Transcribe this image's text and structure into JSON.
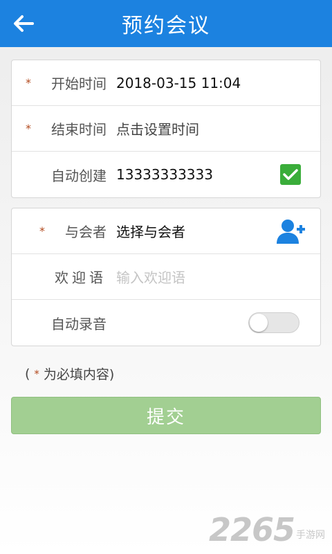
{
  "header": {
    "title": "预约会议",
    "background": "#1c82e0"
  },
  "required_marker": "*",
  "form_main": {
    "start_time": {
      "label": "开始时间",
      "value": "2018-03-15 11:04",
      "required": true
    },
    "end_time": {
      "label": "结束时间",
      "value": "点击设置时间",
      "required": true
    },
    "auto_create": {
      "label": "自动创建",
      "value": "13333333333",
      "checked": true,
      "check_color": "#3aad3a"
    }
  },
  "form_participants": {
    "participants": {
      "label": "与会者",
      "value": "选择与会者",
      "required": true,
      "icon": "add-person-icon",
      "icon_color": "#1c82e0"
    },
    "welcome": {
      "label": "欢迎语",
      "placeholder": "输入欢迎语"
    },
    "auto_record": {
      "label": "自动录音",
      "on": false
    }
  },
  "note": {
    "open": "(",
    "text": "为必填内容)"
  },
  "submit": {
    "label": "提交",
    "color": "#a2cf92"
  },
  "watermark": {
    "number": "2265",
    "text": "手游网"
  }
}
